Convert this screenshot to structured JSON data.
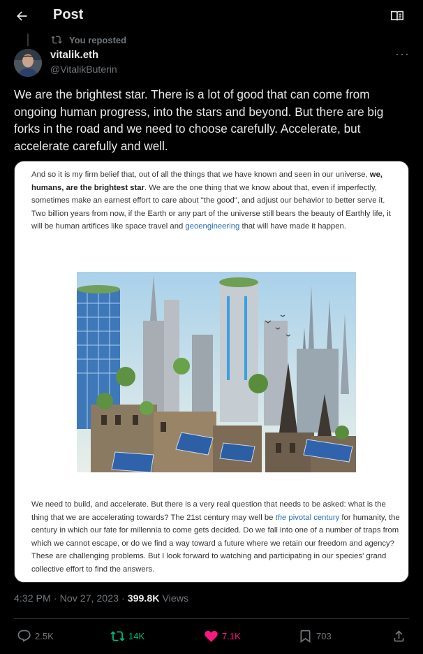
{
  "header": {
    "title": "Post"
  },
  "repost": {
    "label": "You reposted"
  },
  "author": {
    "name": "vitalik.eth",
    "handle": "@VitalikButerin"
  },
  "tweet": {
    "text": "We are the brightest star. There is a lot of good that can come from ongoing human progress, into the stars  and beyond. But there are big forks in the road and we need to choose carefully. Accelerate, but accelerate carefully and well."
  },
  "media": {
    "para1_a": "And so it is my firm belief that, out of all the things that we have known and seen in our universe, ",
    "para1_bold": "we, humans, are the brightest star",
    "para1_b": ". We are the one thing that we know about that, even if imperfectly, sometimes make an earnest effort to care about \"the good\", and adjust our behavior to better serve it. Two billion years from now, if the Earth or any part of the universe still bears the beauty of Earthly life, it will be human artifices like space travel and ",
    "para1_link": "geoengineering",
    "para1_c": " that will have made it happen.",
    "para2_a": "We need to build, and accelerate. But there is a very real question that needs to be asked: what is the thing that we are accelerating towards? The 21st century may well be ",
    "para2_link_italic": "the",
    "para2_link": " pivotal century",
    "para2_b": " for humanity, the century in which our fate for millennia to come gets decided. Do we fall into one of a number of traps from which we cannot escape, or do we find a way toward a future where we retain our freedom and agency? These are challenging problems. But I look forward to watching and participating in our species' grand collective effort to find the answers."
  },
  "meta": {
    "time": "4:32 PM",
    "sep": "·",
    "date": "Nov 27, 2023",
    "sep2": "·",
    "views": "399.8K",
    "views_label": "Views"
  },
  "actions": {
    "replies": "2.5K",
    "reposts": "14K",
    "likes": "7.1K",
    "bookmarks": "703"
  },
  "icons": [
    "back-arrow-icon",
    "reader-mode-icon",
    "repost-icon",
    "more-icon",
    "reply-icon",
    "heart-icon",
    "bookmark-icon",
    "share-icon"
  ],
  "colors": {
    "background": "#000000",
    "text": "#e7e9ea",
    "muted": "#71767b",
    "repost_green": "#00ba7c",
    "like_pink": "#f91880",
    "link_blue": "#2a6db8"
  }
}
